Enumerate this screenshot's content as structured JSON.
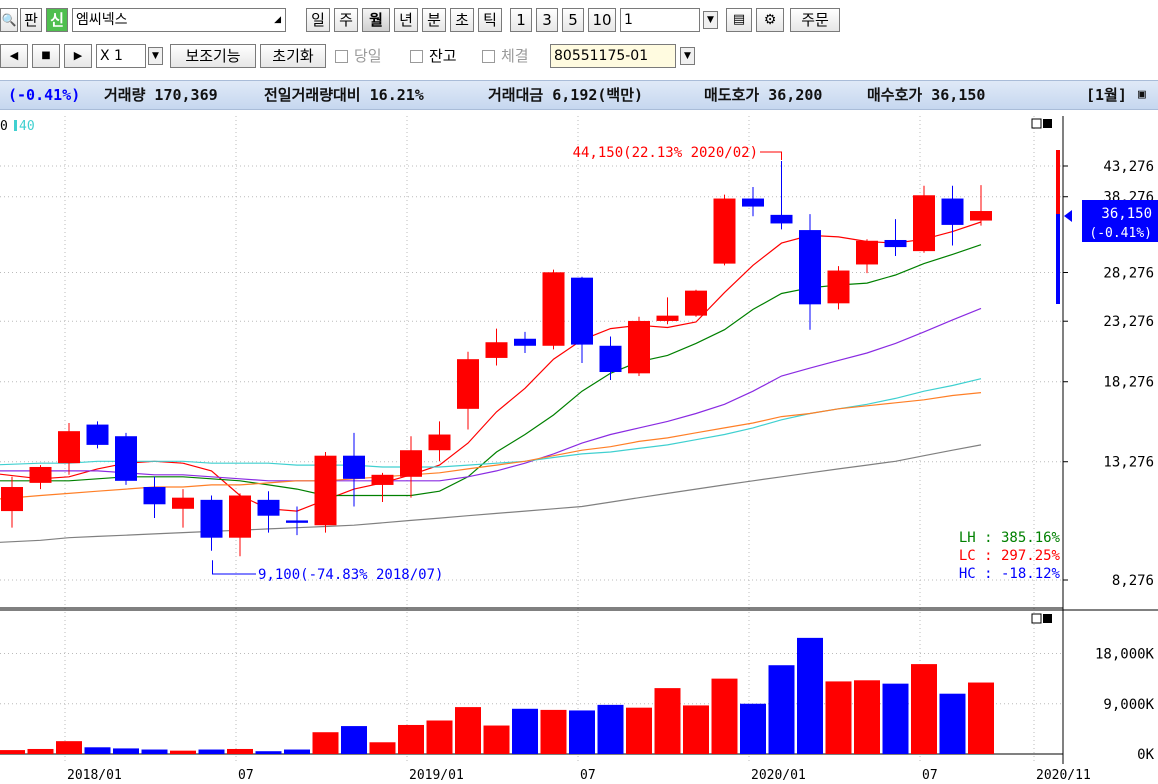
{
  "toolbar1": {
    "search_icon": "search-icon",
    "tab_pan": "판",
    "tab_sin": "신",
    "stock_name": "엠씨넥스",
    "periods": [
      "일",
      "주",
      "월",
      "년",
      "분",
      "초",
      "틱"
    ],
    "active_period": "월",
    "numbers": [
      "1",
      "3",
      "5",
      "10"
    ],
    "count_value": "1",
    "order_button": "주문"
  },
  "toolbar2": {
    "multiplier": "X 1",
    "aux_button": "보조기능",
    "reset_button": "초기화",
    "check_today": "당일",
    "check_balance": "잔고",
    "check_exec": "체결",
    "account": "80551175-01"
  },
  "infobar": {
    "change": "(-0.41%)",
    "volume": "거래량 170,369",
    "prev_volume_ratio": "전일거래량대비 16.21%",
    "amount": "거래대금 6,192(백만)",
    "ask": "매도호가 36,200",
    "bid": "매수호가 36,150",
    "period_label": "[1월]"
  },
  "legend": {
    "prefix": "0",
    "ma40": "40"
  },
  "colors": {
    "up": "#ff0000",
    "down": "#0000ff",
    "ma5": "#ff0000",
    "ma10": "#008000",
    "ma20": "#8a2be2",
    "ma40": "#40d0d0",
    "ma60": "#ff7f27",
    "ma120": "#808080"
  },
  "price_axis": {
    "ticks": [
      "43,276",
      "38,276",
      "28,276",
      "23,276",
      "18,276",
      "13,276",
      "8,276"
    ],
    "current_price": "36,150",
    "current_change": "(-0.41%)"
  },
  "volume_axis": {
    "ticks": [
      "18,000K",
      "9,000K",
      "0K"
    ]
  },
  "x_axis": {
    "labels": [
      "2018/01",
      "07",
      "2019/01",
      "07",
      "2020/01",
      "07",
      "2020/11"
    ]
  },
  "annotations": {
    "high": "44,150(22.13% 2020/02)",
    "low": "9,100(-74.83% 2018/07)",
    "lh": "LH :  385.16%",
    "lc": "LC :  297.25%",
    "hc": "HC :  -18.12%"
  },
  "chart_data": {
    "type": "candlestick",
    "ylim": [
      8276,
      45276
    ],
    "candles": [
      {
        "o": 10900,
        "h": 12500,
        "l": 10200,
        "c": 12000
      },
      {
        "o": 12200,
        "h": 13100,
        "l": 11900,
        "c": 13000
      },
      {
        "o": 13200,
        "h": 15500,
        "l": 12600,
        "c": 15000
      },
      {
        "o": 15400,
        "h": 15600,
        "l": 14000,
        "c": 14200
      },
      {
        "o": 14700,
        "h": 14900,
        "l": 12100,
        "c": 12300
      },
      {
        "o": 12000,
        "h": 12500,
        "l": 10600,
        "c": 11200
      },
      {
        "o": 11000,
        "h": 11900,
        "l": 10200,
        "c": 11500
      },
      {
        "o": 11400,
        "h": 11600,
        "l": 9300,
        "c": 9800
      },
      {
        "o": 9800,
        "h": 11700,
        "l": 9100,
        "c": 11600
      },
      {
        "o": 11400,
        "h": 11800,
        "l": 10000,
        "c": 10700
      },
      {
        "o": 10500,
        "h": 11100,
        "l": 9900,
        "c": 10400
      },
      {
        "o": 10300,
        "h": 13800,
        "l": 10000,
        "c": 13600
      },
      {
        "o": 13600,
        "h": 14900,
        "l": 11100,
        "c": 12400
      },
      {
        "o": 12100,
        "h": 12700,
        "l": 11300,
        "c": 12600
      },
      {
        "o": 12500,
        "h": 14700,
        "l": 11500,
        "c": 13900
      },
      {
        "o": 13900,
        "h": 15600,
        "l": 13300,
        "c": 14800
      },
      {
        "o": 16400,
        "h": 20600,
        "l": 15100,
        "c": 20000
      },
      {
        "o": 20100,
        "h": 22600,
        "l": 19500,
        "c": 21400
      },
      {
        "o": 21700,
        "h": 22300,
        "l": 20500,
        "c": 21100
      },
      {
        "o": 21100,
        "h": 28600,
        "l": 20800,
        "c": 28300
      },
      {
        "o": 27700,
        "h": 27800,
        "l": 19700,
        "c": 21200
      },
      {
        "o": 21100,
        "h": 21900,
        "l": 18400,
        "c": 19000
      },
      {
        "o": 18900,
        "h": 23700,
        "l": 18700,
        "c": 23300
      },
      {
        "o": 23300,
        "h": 25600,
        "l": 23000,
        "c": 23800
      },
      {
        "o": 23800,
        "h": 26400,
        "l": 23700,
        "c": 26300
      },
      {
        "o": 29300,
        "h": 38600,
        "l": 29100,
        "c": 38000
      },
      {
        "o": 38000,
        "h": 39800,
        "l": 35400,
        "c": 36800
      },
      {
        "o": 35600,
        "h": 44150,
        "l": 33600,
        "c": 34400
      },
      {
        "o": 33500,
        "h": 35700,
        "l": 22500,
        "c": 24900
      },
      {
        "o": 25000,
        "h": 29000,
        "l": 24400,
        "c": 28500
      },
      {
        "o": 29200,
        "h": 32300,
        "l": 28200,
        "c": 32100
      },
      {
        "o": 32200,
        "h": 35000,
        "l": 30200,
        "c": 31300
      },
      {
        "o": 30800,
        "h": 40000,
        "l": 30600,
        "c": 38500
      },
      {
        "o": 38000,
        "h": 40000,
        "l": 31500,
        "c": 34200
      },
      {
        "o": 34800,
        "h": 40100,
        "l": 34100,
        "c": 36150
      }
    ],
    "volume": [
      700,
      900,
      2300,
      1200,
      1000,
      800,
      600,
      800,
      900,
      500,
      800,
      3900,
      5000,
      2100,
      5200,
      6000,
      8400,
      5100,
      8100,
      7900,
      7800,
      8800,
      8300,
      11800,
      8700,
      13500,
      9000,
      15900,
      20800,
      13000,
      13200,
      12600,
      16100,
      10800,
      12800
    ],
    "moving_averages": [
      {
        "name": "5",
        "values": [
          12700,
          12400,
          12500,
          12900,
          13200,
          13300,
          13200,
          12800,
          11600,
          11000,
          10900,
          11400,
          11900,
          12200,
          12600,
          13100,
          14300,
          16200,
          17800,
          20000,
          21600,
          22600,
          22900,
          22700,
          23200,
          26100,
          29100,
          31800,
          32800,
          32600,
          32000,
          31800,
          32300,
          33300,
          34600
        ]
      },
      {
        "name": "10",
        "values": [
          12300,
          12300,
          12300,
          12400,
          12500,
          12500,
          12500,
          12400,
          12300,
          12100,
          11900,
          11600,
          11600,
          11600,
          11600,
          11800,
          12500,
          13800,
          14800,
          16000,
          17600,
          18900,
          19800,
          20300,
          21300,
          22500,
          24400,
          26000,
          26600,
          26900,
          27100,
          28000,
          29300,
          30400,
          31600
        ]
      },
      {
        "name": "20",
        "values": [
          12800,
          12800,
          12800,
          12800,
          12700,
          12600,
          12600,
          12500,
          12400,
          12300,
          12300,
          12300,
          12300,
          12300,
          12300,
          12300,
          12500,
          12800,
          13200,
          13700,
          14300,
          14800,
          15200,
          15600,
          16100,
          16700,
          17600,
          18700,
          19300,
          19900,
          20500,
          21300,
          22300,
          23400,
          24500
        ]
      },
      {
        "name": "40",
        "values": [
          13100,
          13200,
          13200,
          13300,
          13300,
          13300,
          13300,
          13200,
          13200,
          13200,
          13100,
          13100,
          13100,
          13000,
          13000,
          13000,
          13100,
          13200,
          13300,
          13500,
          13700,
          13800,
          14000,
          14200,
          14500,
          14800,
          15200,
          15700,
          16100,
          16400,
          16700,
          17100,
          17600,
          18000,
          18500
        ]
      },
      {
        "name": "60",
        "values": [
          11400,
          11600,
          11700,
          11800,
          11900,
          12000,
          12000,
          12100,
          12100,
          12200,
          12300,
          12300,
          12400,
          12500,
          12600,
          12700,
          12900,
          13100,
          13300,
          13600,
          13900,
          14100,
          14400,
          14600,
          14900,
          15200,
          15500,
          15900,
          16100,
          16400,
          16600,
          16800,
          17000,
          17300,
          17500
        ]
      },
      {
        "name": "120",
        "values": [
          9600,
          9700,
          9800,
          9850,
          9900,
          9950,
          10000,
          10050,
          10100,
          10150,
          10200,
          10250,
          10300,
          10400,
          10500,
          10600,
          10700,
          10800,
          10900,
          11000,
          11100,
          11300,
          11500,
          11700,
          11900,
          12100,
          12300,
          12500,
          12700,
          12900,
          13100,
          13300,
          13600,
          13900,
          14200
        ]
      }
    ],
    "volume_ylim": [
      0,
      24000
    ]
  }
}
